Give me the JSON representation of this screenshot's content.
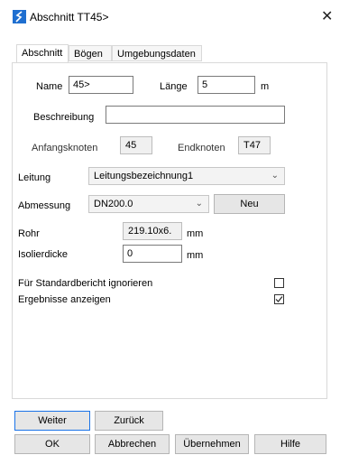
{
  "window": {
    "title": "Abschnitt TT45>",
    "close_glyph": "✕"
  },
  "tabs": [
    {
      "label": "Abschnitt",
      "active": true
    },
    {
      "label": "Bögen",
      "active": false
    },
    {
      "label": "Umgebungsdaten",
      "active": false
    }
  ],
  "form": {
    "name_label": "Name",
    "name_value": "45>",
    "laenge_label": "Länge",
    "laenge_value": "5",
    "laenge_unit": "m",
    "beschreibung_label": "Beschreibung",
    "beschreibung_value": "",
    "anfangsknoten_label": "Anfangsknoten",
    "anfangsknoten_value": "45",
    "endknoten_label": "Endknoten",
    "endknoten_value": "T47",
    "leitung_label": "Leitung",
    "leitung_value": "Leitungsbezeichnung1",
    "abmessung_label": "Abmessung",
    "abmessung_value": "DN200.0",
    "neu_label": "Neu",
    "rohr_label": "Rohr",
    "rohr_value": "219.10x6.",
    "rohr_unit": "mm",
    "isolier_label": "Isolierdicke",
    "isolier_value": "0",
    "isolier_unit": "mm",
    "standardbericht_label": "Für Standardbericht ignorieren",
    "standardbericht_checked": false,
    "ergebnisse_label": "Ergebnisse anzeigen",
    "ergebnisse_checked": true
  },
  "buttons": {
    "weiter": "Weiter",
    "zurueck": "Zurück",
    "ok": "OK",
    "abbrechen": "Abbrechen",
    "uebernehmen": "Übernehmen",
    "hilfe": "Hilfe"
  },
  "colors": {
    "accent": "#1a73e8",
    "icon": "#1f6fd0"
  },
  "icons": {
    "app": "piping-app-icon",
    "combo": "chevron-down-icon",
    "check": "checkmark-icon"
  }
}
